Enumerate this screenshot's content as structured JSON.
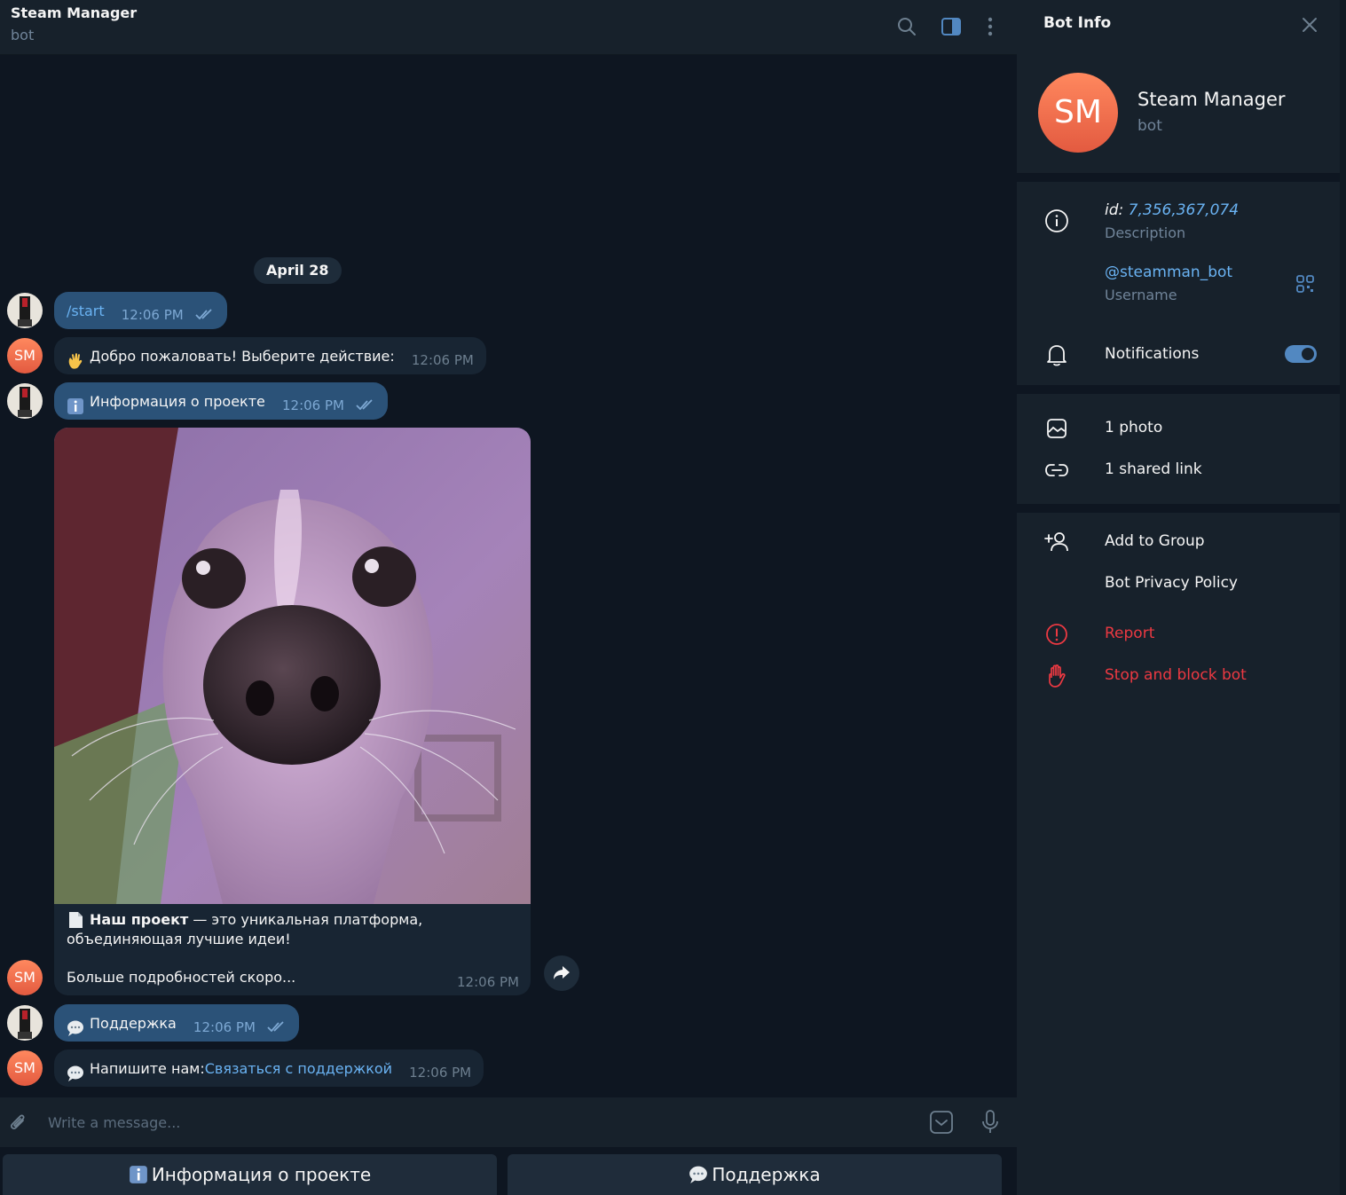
{
  "chat": {
    "title": "Steam Manager",
    "subtitle": "bot",
    "date_pill": "April 28",
    "messages": [
      {
        "direction": "out",
        "text": "/start",
        "time": "12:06 PM"
      },
      {
        "direction": "in",
        "avatar": "SM",
        "text": "Добро пожаловать! Выберите действие:",
        "time": "12:06 PM"
      },
      {
        "direction": "out",
        "text": "Информация о проекте",
        "time": "12:06 PM"
      },
      {
        "direction": "in",
        "avatar": "SM",
        "caption_bold": "Наш проект",
        "caption_rest": " — это уникальная платформа, объединяющая лучшие идеи!",
        "caption_more": "Больше подробностей скоро...",
        "time": "12:06 PM"
      },
      {
        "direction": "out",
        "text": "Поддержка",
        "time": "12:06 PM"
      },
      {
        "direction": "in",
        "avatar": "SM",
        "text_prefix": "Напишите нам: ",
        "link": "Связаться с поддержкой",
        "time": "12:06 PM"
      }
    ],
    "composer_placeholder": "Write a message...",
    "keyboard": [
      "Информация о проекте",
      "Поддержка"
    ]
  },
  "info": {
    "title": "Bot Info",
    "avatar": "SM",
    "name": "Steam Manager",
    "kind": "bot",
    "id_label": "id:",
    "id_value": "7,356,367,074",
    "description_label": "Description",
    "username": "@steamman_bot",
    "username_label": "Username",
    "notifications": "Notifications",
    "notifications_on": true,
    "photos": "1 photo",
    "links": "1 shared link",
    "add_to_group": "Add to Group",
    "privacy": "Bot Privacy Policy",
    "report": "Report",
    "stop": "Stop and block bot"
  },
  "colors": {
    "accent": "#5288c1",
    "link": "#6ab3f3",
    "danger": "#ec3942",
    "outgoing_bubble": "#2b5278",
    "incoming_bubble": "#182533",
    "avatar_sm": "#e35a40"
  }
}
